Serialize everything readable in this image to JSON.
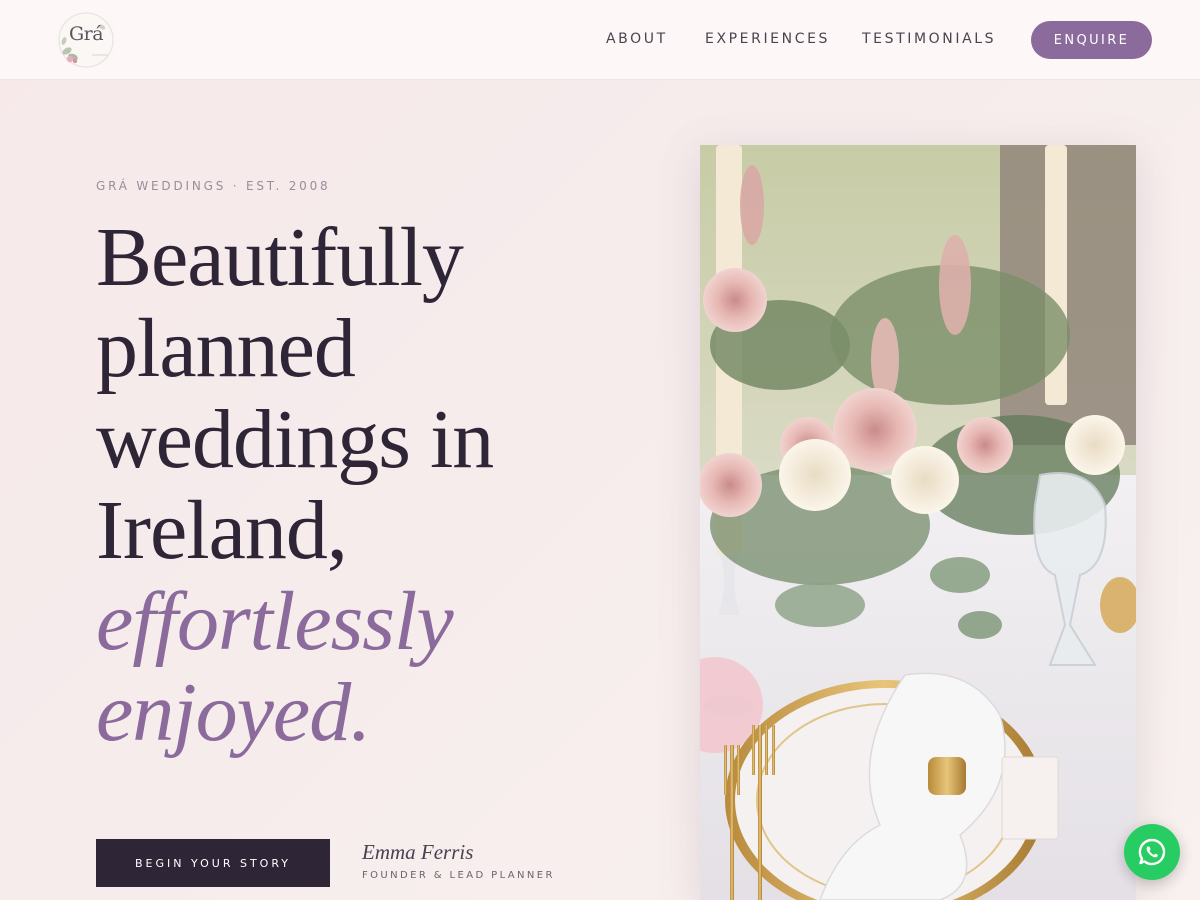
{
  "header": {
    "logo_text": "Grá",
    "nav": [
      {
        "label": "ABOUT"
      },
      {
        "label": "EXPERIENCES"
      },
      {
        "label": "TESTIMONIALS"
      }
    ],
    "cta_label": "ENQUIRE"
  },
  "hero": {
    "eyebrow": "GRÁ WEDDINGS · EST. 2008",
    "headline_lines": [
      "Beautifully",
      "planned",
      "weddings in",
      "Ireland,"
    ],
    "headline_accent_lines": [
      "effortlessly",
      "enjoyed."
    ],
    "cta_label": "BEGIN YOUR STORY",
    "signature_name": "Emma Ferris",
    "signature_role": "FOUNDER & LEAD PLANNER"
  },
  "icons": {
    "logo": "floral-wreath-logo",
    "floating": "whatsapp-icon"
  },
  "colors": {
    "accent": "#8b6a9c",
    "dark": "#2e2536",
    "whatsapp": "#27cc62"
  }
}
